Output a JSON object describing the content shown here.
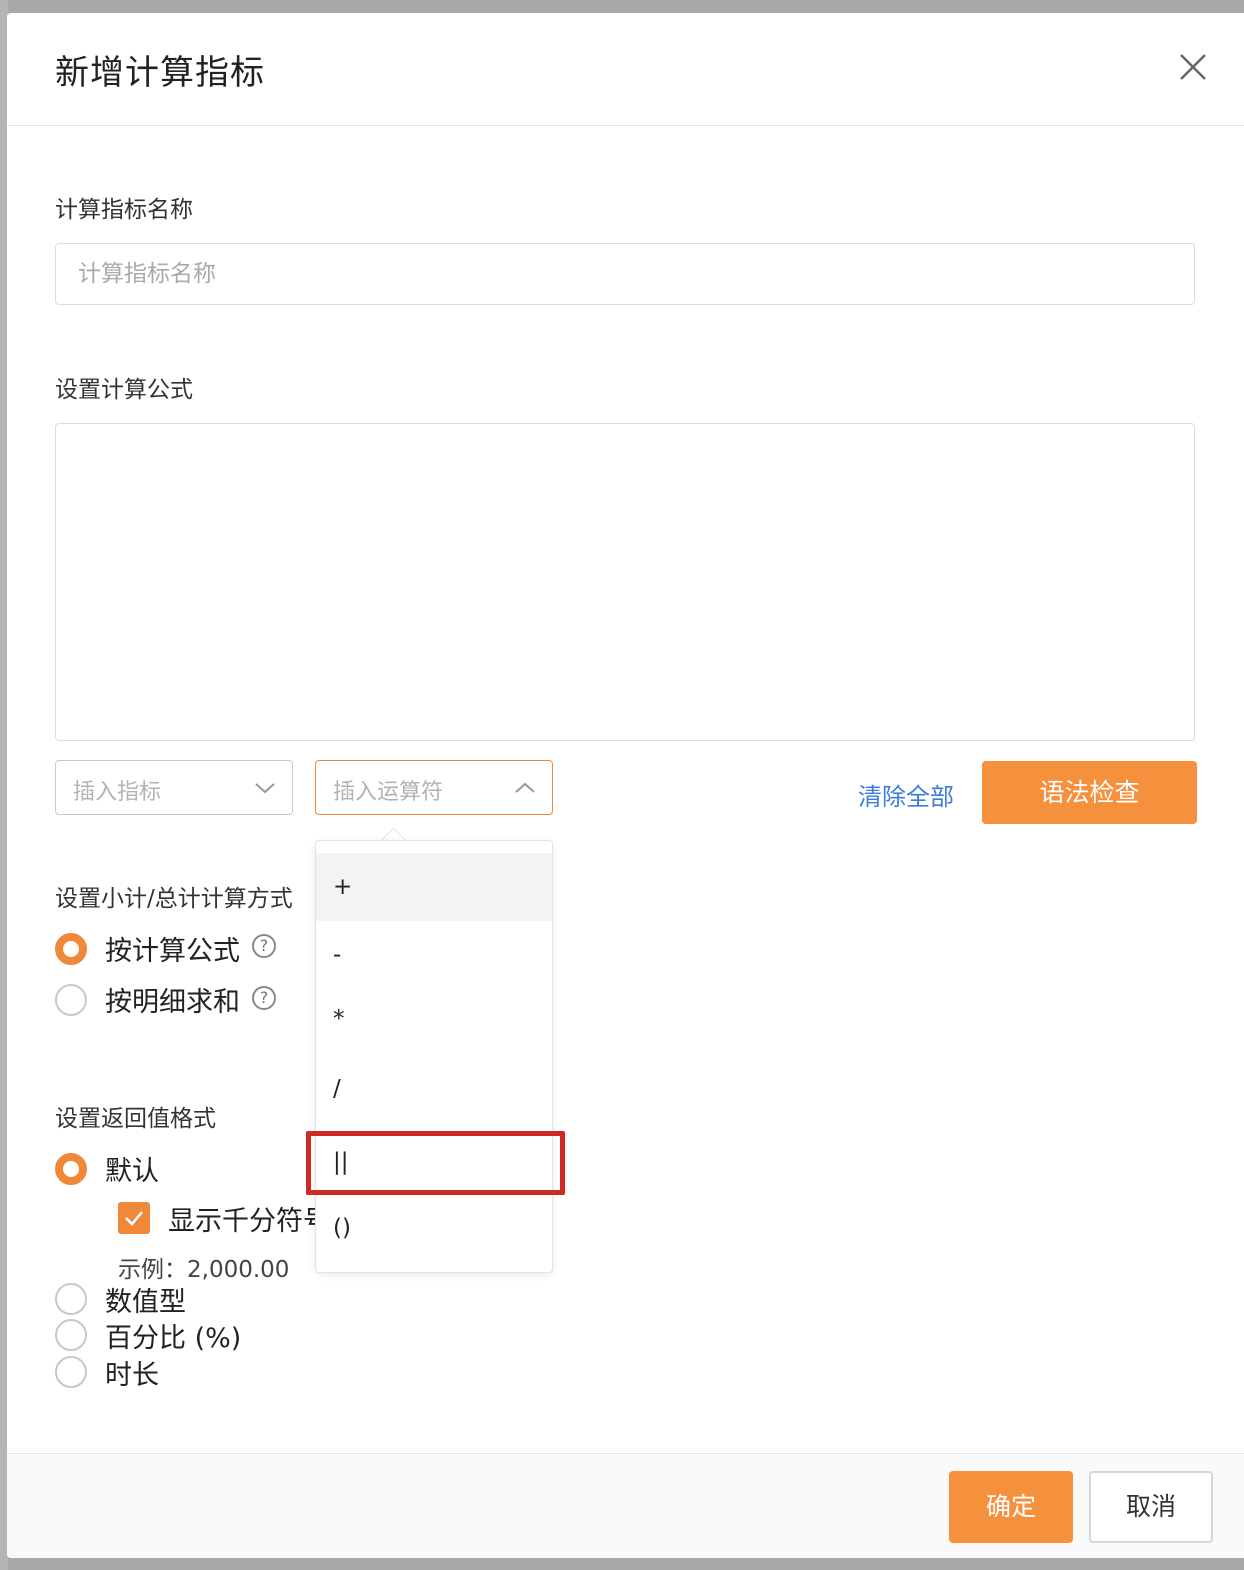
{
  "dialog": {
    "title": "新增计算指标"
  },
  "name_field": {
    "label": "计算指标名称",
    "placeholder": "计算指标名称",
    "value": ""
  },
  "formula": {
    "label": "设置计算公式",
    "value": "",
    "insert_metric_placeholder": "插入指标",
    "insert_operator_placeholder": "插入运算符",
    "clear_all_label": "清除全部",
    "syntax_check_label": "语法检查",
    "operators": [
      "+",
      "-",
      "*",
      "/",
      "||",
      "()"
    ],
    "hovered_operator": "+",
    "highlighted_operator": "||"
  },
  "subtotal": {
    "label": "设置小计/总计计算方式",
    "options": [
      {
        "label": "按计算公式",
        "checked": true
      },
      {
        "label": "按明细求和",
        "checked": false
      }
    ],
    "help_glyph": "?"
  },
  "return_format": {
    "label": "设置返回值格式",
    "options": [
      {
        "label": "默认",
        "checked": true
      },
      {
        "label": "数值型",
        "checked": false
      },
      {
        "label": "百分比 (%)",
        "checked": false
      },
      {
        "label": "时长",
        "checked": false
      }
    ],
    "thousands_separator_label": "显示千分符号",
    "thousands_separator_checked": true,
    "example_text": "示例：2,000.00"
  },
  "footer": {
    "confirm_label": "确定",
    "cancel_label": "取消"
  },
  "colors": {
    "accent": "#f5903c",
    "link": "#3b7dd8",
    "highlight": "#cc2a22"
  }
}
